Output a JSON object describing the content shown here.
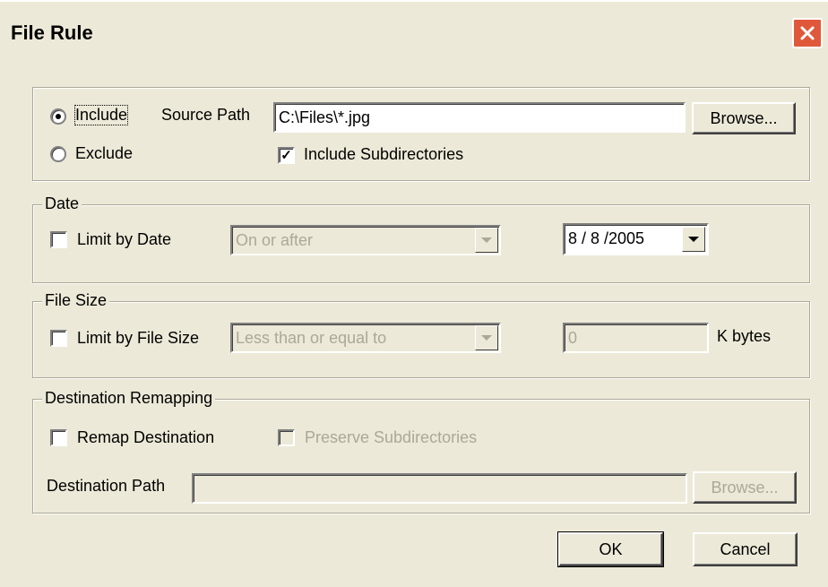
{
  "window": {
    "title": "File Rule"
  },
  "rule_type": {
    "include_label": "Include",
    "exclude_label": "Exclude",
    "selected": "include"
  },
  "source": {
    "path_label": "Source Path",
    "path_value": "C:\\Files\\*.jpg",
    "browse_label": "Browse...",
    "include_subdirs_label": "Include Subdirectories",
    "include_subdirs_checked": true
  },
  "date": {
    "group_title": "Date",
    "limit_label": "Limit by Date",
    "limit_checked": false,
    "condition_value": "On or after",
    "date_value": "8 / 8 /2005"
  },
  "file_size": {
    "group_title": "File Size",
    "limit_label": "Limit by File Size",
    "limit_checked": false,
    "condition_value": "Less than or equal to",
    "size_value": "0",
    "unit_label": "K bytes"
  },
  "destination": {
    "group_title": "Destination Remapping",
    "remap_label": "Remap Destination",
    "remap_checked": false,
    "preserve_label": "Preserve Subdirectories",
    "preserve_checked": false,
    "path_label": "Destination Path",
    "path_value": "",
    "browse_label": "Browse..."
  },
  "actions": {
    "ok_label": "OK",
    "cancel_label": "Cancel"
  },
  "icons": {
    "close": "close-icon",
    "dropdown": "chevron-down-icon",
    "check": "check-icon"
  }
}
